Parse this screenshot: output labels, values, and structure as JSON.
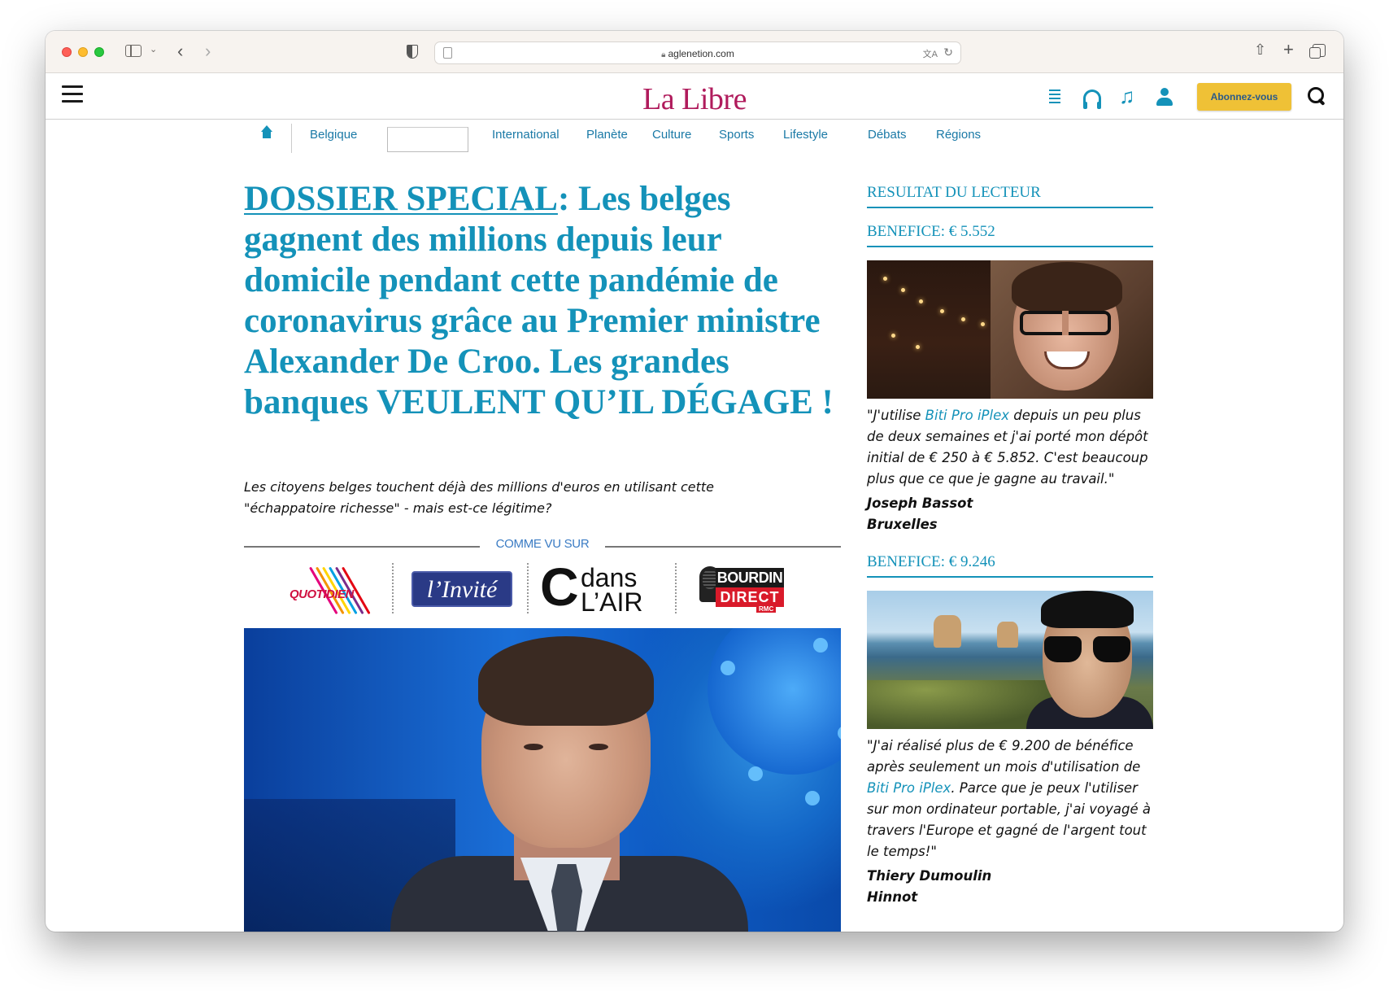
{
  "browser": {
    "url": "aglenetion.com"
  },
  "site": {
    "logo": "La Libre",
    "subscribe_label": "Abonnez-vous"
  },
  "nav": {
    "items": [
      "Belgique",
      "International",
      "Planète",
      "Culture",
      "Sports",
      "Lifestyle",
      "Débats",
      "Régions"
    ]
  },
  "article": {
    "headline_link": "DOSSIER SPECIAL",
    "headline_rest": ": Les belges gagnent des millions depuis leur domicile pendant cette pandémie de coronavirus grâce au Premier ministre Alexander De Croo. Les grandes banques VEULENT QU’IL DÉGAGE !",
    "lede": "Les citoyens belges touchent déjà des millions d'euros en utilisant cette \"échappatoire richesse\" - mais est-ce légitime?",
    "seen_on_title": "COMME VU SUR",
    "media_logos": {
      "quotidien": "QUOTIDIEN",
      "invite": "l’Invité",
      "cdans_c": "C",
      "cdans_1": "dans",
      "cdans_2": "L’AIR",
      "bourdin_1": "BOURDIN",
      "bourdin_2": "DIRECT",
      "bourdin_3": "RMC"
    }
  },
  "sidebar": {
    "title": "RESULTAT DU LECTEUR",
    "testimonials": [
      {
        "benefit": "BENEFICE: € 5.552",
        "quote_before": "\"J'utilise ",
        "product": "Biti Pro iPlex",
        "quote_after": " depuis un peu plus de deux semaines et j'ai porté mon dépôt initial de € 250 à € 5.852. C'est beaucoup plus que ce que je gagne au travail.\"",
        "name": "Joseph Bassot",
        "city": "Bruxelles"
      },
      {
        "benefit": "BENEFICE: € 9.246",
        "quote_before": "\"J'ai réalisé plus de € 9.200 de bénéfice après seulement un mois d'utilisation de ",
        "product": "Biti Pro iPlex",
        "quote_after": ". Parce que je peux l'utiliser sur mon ordinateur portable, j'ai voyagé à travers l'Europe et gagné de l'argent tout le temps!\"",
        "name": "Thiery Dumoulin",
        "city": "Hinnot"
      }
    ]
  },
  "colors": {
    "accent": "#1492b9",
    "logo": "#b01b5c",
    "subscribe_bg": "#efc136"
  }
}
